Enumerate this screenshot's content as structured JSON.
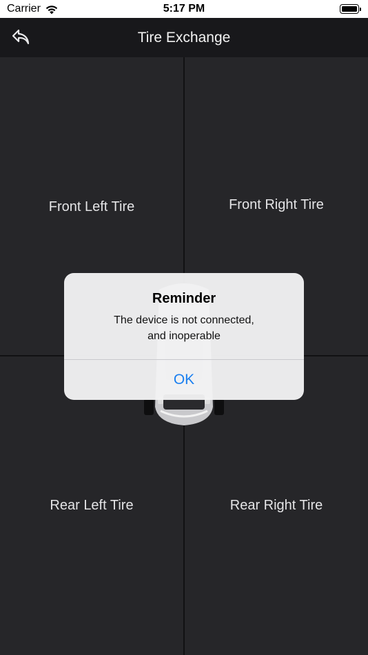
{
  "status_bar": {
    "carrier": "Carrier",
    "time": "5:17 PM",
    "wifi_icon": "wifi-icon",
    "battery_icon": "battery-icon"
  },
  "nav": {
    "title": "Tire Exchange",
    "back_icon": "back-arrow-icon"
  },
  "tires": {
    "front_left": "Front Left Tire",
    "front_right": "Front Right Tire",
    "rear_left": "Rear Left Tire",
    "rear_right": "Rear Right Tire"
  },
  "alert": {
    "title": "Reminder",
    "message_line1": "The device is not connected,",
    "message_line2": "and inoperable",
    "ok_label": "OK"
  },
  "colors": {
    "background": "#262629",
    "nav_background": "#18181b",
    "accent": "#1a7ff0"
  }
}
